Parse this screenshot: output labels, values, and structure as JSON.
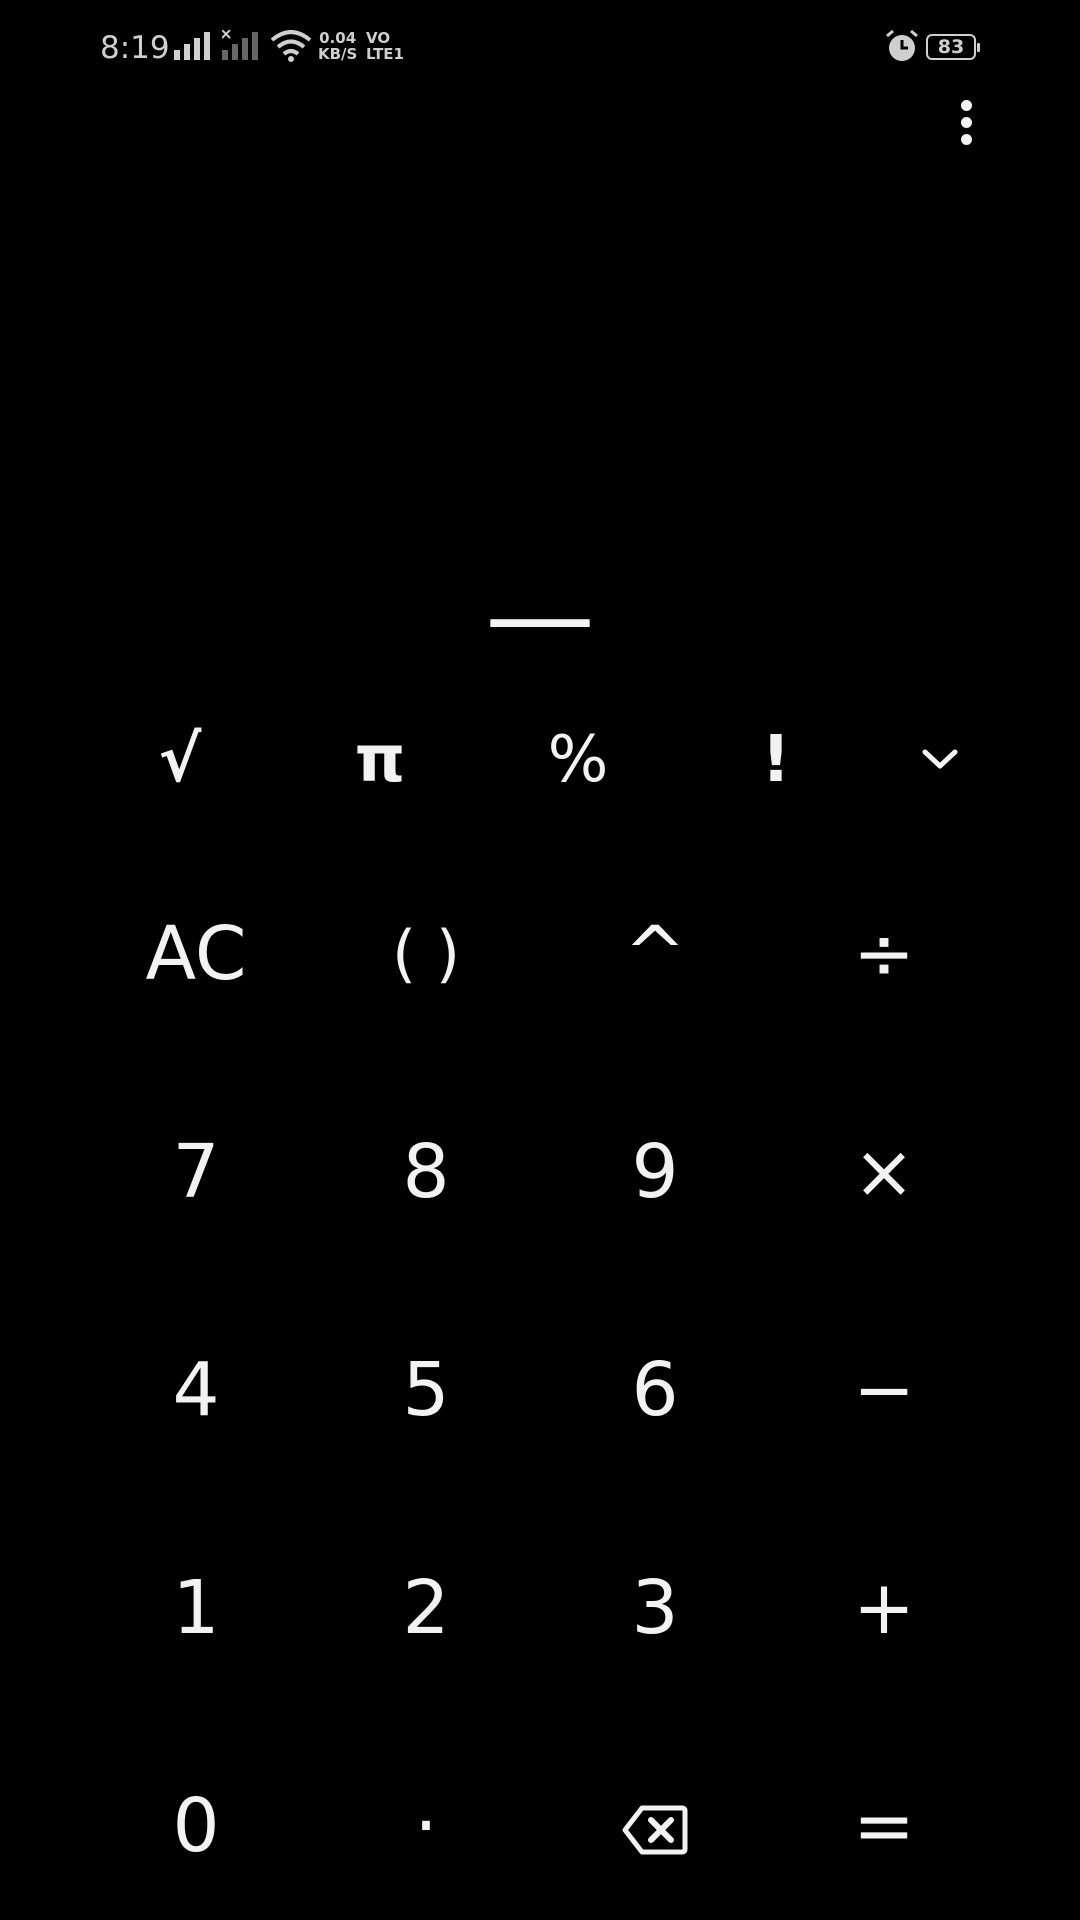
{
  "status_bar": {
    "time": "8:19",
    "net_speed_value": "0.04",
    "net_speed_unit": "KB/S",
    "volte_top": "VO",
    "volte_bottom": "LTE1",
    "battery_level": "83"
  },
  "display": {
    "result": "—"
  },
  "scientific_keys": {
    "sqrt": "√",
    "pi": "π",
    "percent": "%",
    "factorial": "!"
  },
  "keypad": {
    "clear": "AC",
    "parentheses": "( )",
    "power": "^",
    "divide": "÷",
    "seven": "7",
    "eight": "8",
    "nine": "9",
    "multiply": "×",
    "four": "4",
    "five": "5",
    "six": "6",
    "minus": "−",
    "one": "1",
    "two": "2",
    "three": "3",
    "plus": "+",
    "zero": "0",
    "decimal": "·",
    "equals": "="
  },
  "icons": {
    "overflow_menu": "more-vert-icon",
    "expand": "chevron-down-icon",
    "backspace": "backspace-icon",
    "alarm": "alarm-icon",
    "wifi": "wifi-icon",
    "signal": "signal-icon",
    "battery": "battery-icon"
  },
  "colors": {
    "background": "#000000",
    "key_text": "#f2f2f2",
    "status_text": "#cfcfcf"
  }
}
